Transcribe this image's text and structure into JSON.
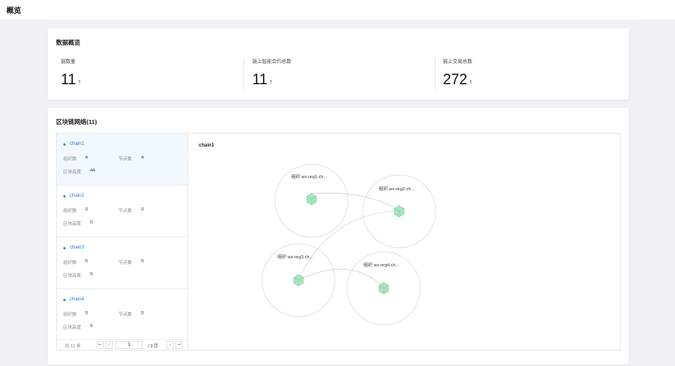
{
  "header": {
    "title": "概览"
  },
  "overview": {
    "title": "数据概览",
    "stats": [
      {
        "label": "链数量",
        "value": "11",
        "trend_icon": "arrow-up-icon"
      },
      {
        "label": "链上智能合约总数",
        "value": "11",
        "trend_icon": "arrow-up-icon"
      },
      {
        "label": "链上交易总数",
        "value": "272",
        "trend_icon": "arrow-up-icon"
      }
    ]
  },
  "network": {
    "title": "区块链网络(11)",
    "labels": {
      "orgs": "组织数",
      "nodes": "节点数",
      "height": "区块高度"
    },
    "chains": [
      {
        "name": "chain1",
        "orgs": "4",
        "nodes": "4",
        "height": "44",
        "active": true
      },
      {
        "name": "chain2",
        "orgs": "0",
        "nodes": "0",
        "height": "0"
      },
      {
        "name": "chain3",
        "orgs": "0",
        "nodes": "0",
        "height": "0"
      },
      {
        "name": "chain4",
        "orgs": "0",
        "nodes": "0",
        "height": "0"
      }
    ],
    "pager": {
      "total": "共 11 条",
      "page": "1",
      "pages": "/ 3 页"
    },
    "graph": {
      "title": "chain1",
      "orgs": [
        "组织 wx-org1.ch...",
        "组织 wx-org2.ch...",
        "组织 wx-org3.ch...",
        "组织 wx-org4.ch..."
      ],
      "node_icon": "cube-icon",
      "node_color": "#8fdcae"
    }
  }
}
